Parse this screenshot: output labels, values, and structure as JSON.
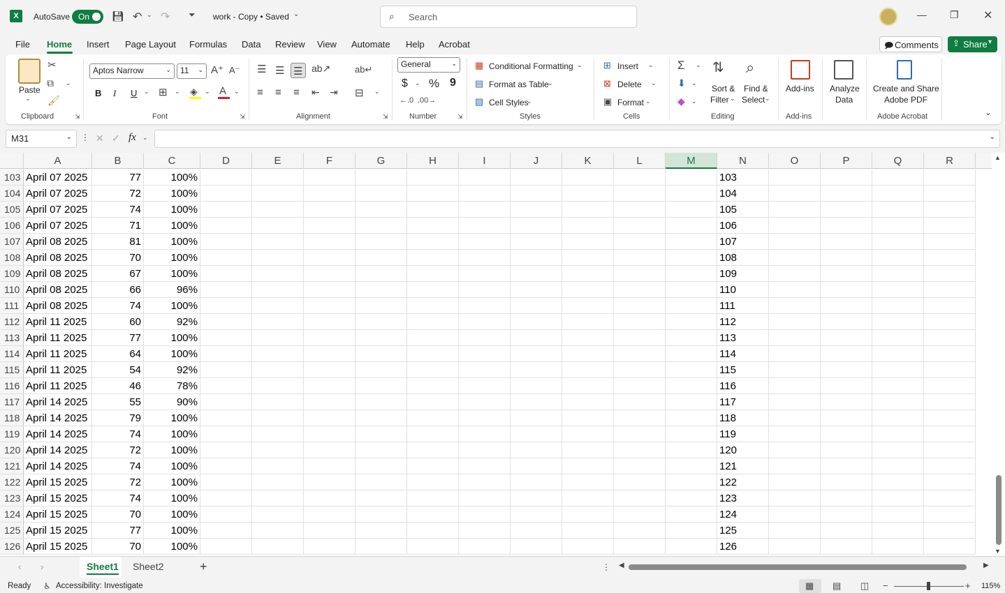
{
  "app": {
    "logo": "X",
    "autosave_label": "AutoSave",
    "autosave_state": "On",
    "doc_title": "work - Copy • Saved",
    "search_placeholder": "Search",
    "accent": "#107c41"
  },
  "menu": {
    "items": [
      "File",
      "Home",
      "Insert",
      "Page Layout",
      "Formulas",
      "Data",
      "Review",
      "View",
      "Automate",
      "Help",
      "Acrobat"
    ],
    "active": "Home",
    "comments_label": "Comments",
    "share_label": "Share"
  },
  "ribbon": {
    "clipboard": {
      "paste": "Paste",
      "label": "Clipboard"
    },
    "font": {
      "name": "Aptos Narrow",
      "size": "11",
      "bold": "B",
      "italic": "I",
      "underline": "U",
      "label": "Font"
    },
    "alignment": {
      "label": "Alignment"
    },
    "number": {
      "format": "General",
      "currency": "$",
      "percent": "%",
      "comma": "9",
      "label": "Number"
    },
    "styles": {
      "conditional": "Conditional Formatting",
      "table": "Format as Table",
      "cell_styles": "Cell Styles",
      "label": "Styles"
    },
    "cells": {
      "insert": "Insert",
      "delete": "Delete",
      "format": "Format",
      "label": "Cells"
    },
    "editing": {
      "sort_line1": "Sort &",
      "sort_line2": "Filter",
      "find_line1": "Find &",
      "find_line2": "Select",
      "label": "Editing"
    },
    "addins": {
      "button": "Add-ins",
      "label": "Add-ins"
    },
    "analyze": {
      "line1": "Analyze",
      "line2": "Data"
    },
    "acrobat": {
      "line1": "Create and Share",
      "line2": "Adobe PDF",
      "label": "Adobe Acrobat"
    }
  },
  "formula_bar": {
    "name_box": "M31",
    "fx": "fx",
    "value": ""
  },
  "columns": [
    "A",
    "B",
    "C",
    "D",
    "E",
    "F",
    "G",
    "H",
    "I",
    "J",
    "K",
    "L",
    "M",
    "N",
    "O",
    "P",
    "Q",
    "R"
  ],
  "selected_column": "M",
  "rows": [
    {
      "n": "103",
      "a": "April 07 2025",
      "b": "77",
      "c": "100%"
    },
    {
      "n": "104",
      "a": "April 07 2025",
      "b": "72",
      "c": "100%"
    },
    {
      "n": "105",
      "a": "April 07 2025",
      "b": "74",
      "c": "100%"
    },
    {
      "n": "106",
      "a": "April 07 2025",
      "b": "71",
      "c": "100%"
    },
    {
      "n": "107",
      "a": "April 08 2025",
      "b": "81",
      "c": "100%"
    },
    {
      "n": "108",
      "a": "April 08 2025",
      "b": "70",
      "c": "100%"
    },
    {
      "n": "109",
      "a": "April 08 2025",
      "b": "67",
      "c": "100%"
    },
    {
      "n": "110",
      "a": "April 08 2025",
      "b": "66",
      "c": "96%"
    },
    {
      "n": "111",
      "a": "April 08 2025",
      "b": "74",
      "c": "100%"
    },
    {
      "n": "112",
      "a": "April 11 2025",
      "b": "60",
      "c": "92%"
    },
    {
      "n": "113",
      "a": "April 11 2025",
      "b": "77",
      "c": "100%"
    },
    {
      "n": "114",
      "a": "April 11 2025",
      "b": "64",
      "c": "100%"
    },
    {
      "n": "115",
      "a": "April 11 2025",
      "b": "54",
      "c": "92%"
    },
    {
      "n": "116",
      "a": "April 11 2025",
      "b": "46",
      "c": "78%"
    },
    {
      "n": "117",
      "a": "April 14 2025",
      "b": "55",
      "c": "90%"
    },
    {
      "n": "118",
      "a": "April 14 2025",
      "b": "79",
      "c": "100%"
    },
    {
      "n": "119",
      "a": "April 14 2025",
      "b": "74",
      "c": "100%"
    },
    {
      "n": "120",
      "a": "April 14 2025",
      "b": "72",
      "c": "100%"
    },
    {
      "n": "121",
      "a": "April 14 2025",
      "b": "74",
      "c": "100%"
    },
    {
      "n": "122",
      "a": "April 15 2025",
      "b": "72",
      "c": "100%"
    },
    {
      "n": "123",
      "a": "April 15 2025",
      "b": "74",
      "c": "100%"
    },
    {
      "n": "124",
      "a": "April 15 2025",
      "b": "70",
      "c": "100%"
    },
    {
      "n": "125",
      "a": "April 15 2025",
      "b": "77",
      "c": "100%"
    },
    {
      "n": "126",
      "a": "April 15 2025",
      "b": "70",
      "c": "100%"
    }
  ],
  "sheets": {
    "tabs": [
      "Sheet1",
      "Sheet2"
    ],
    "active": "Sheet1",
    "add": "+"
  },
  "status": {
    "ready": "Ready",
    "accessibility": "Accessibility: Investigate",
    "zoom": "115%"
  }
}
